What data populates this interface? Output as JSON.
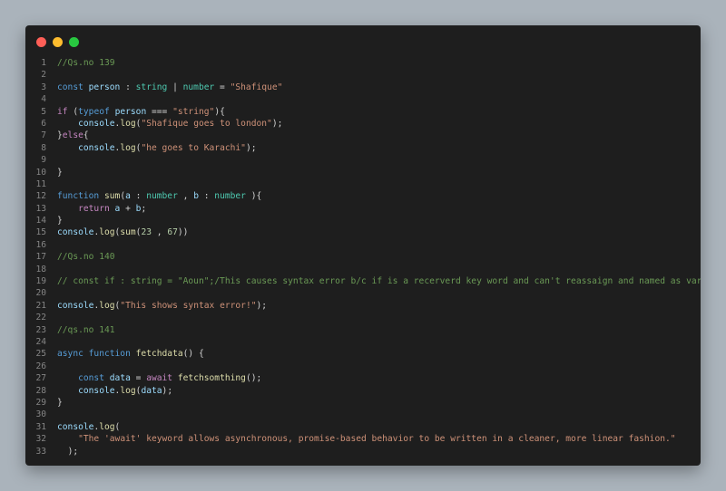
{
  "window": {
    "dots": [
      {
        "name": "close",
        "color": "#ff5f57"
      },
      {
        "name": "minimize",
        "color": "#febc2e"
      },
      {
        "name": "maximize",
        "color": "#28c840"
      }
    ]
  },
  "code": {
    "lines": [
      {
        "n": "1",
        "tokens": [
          {
            "t": "//Qs.no 139",
            "k": "cm"
          }
        ]
      },
      {
        "n": "2",
        "tokens": []
      },
      {
        "n": "3",
        "tokens": [
          {
            "t": "const ",
            "k": "kw"
          },
          {
            "t": "person",
            "k": "var"
          },
          {
            "t": " : ",
            "k": "op"
          },
          {
            "t": "string",
            "k": "ty"
          },
          {
            "t": " | ",
            "k": "op"
          },
          {
            "t": "number",
            "k": "ty"
          },
          {
            "t": " = ",
            "k": "op"
          },
          {
            "t": "\"Shafique\"",
            "k": "str"
          }
        ]
      },
      {
        "n": "4",
        "tokens": []
      },
      {
        "n": "5",
        "tokens": [
          {
            "t": "if",
            "k": "ctl"
          },
          {
            "t": " (",
            "k": "op"
          },
          {
            "t": "typeof",
            "k": "kw"
          },
          {
            "t": " ",
            "k": "op"
          },
          {
            "t": "person",
            "k": "var"
          },
          {
            "t": " === ",
            "k": "op"
          },
          {
            "t": "\"string\"",
            "k": "str"
          },
          {
            "t": "){",
            "k": "op"
          }
        ]
      },
      {
        "n": "6",
        "tokens": [
          {
            "t": "    ",
            "k": "op"
          },
          {
            "t": "console",
            "k": "var"
          },
          {
            "t": ".",
            "k": "op"
          },
          {
            "t": "log",
            "k": "fn"
          },
          {
            "t": "(",
            "k": "op"
          },
          {
            "t": "\"Shafique goes to london\"",
            "k": "str"
          },
          {
            "t": ");",
            "k": "op"
          }
        ]
      },
      {
        "n": "7",
        "tokens": [
          {
            "t": "}",
            "k": "op"
          },
          {
            "t": "else",
            "k": "ctl"
          },
          {
            "t": "{",
            "k": "op"
          }
        ]
      },
      {
        "n": "8",
        "tokens": [
          {
            "t": "    ",
            "k": "op"
          },
          {
            "t": "console",
            "k": "var"
          },
          {
            "t": ".",
            "k": "op"
          },
          {
            "t": "log",
            "k": "fn"
          },
          {
            "t": "(",
            "k": "op"
          },
          {
            "t": "\"he goes to Karachi\"",
            "k": "str"
          },
          {
            "t": ");",
            "k": "op"
          }
        ]
      },
      {
        "n": "9",
        "tokens": []
      },
      {
        "n": "10",
        "tokens": [
          {
            "t": "}",
            "k": "op"
          }
        ]
      },
      {
        "n": "11",
        "tokens": []
      },
      {
        "n": "12",
        "tokens": [
          {
            "t": "function ",
            "k": "kw"
          },
          {
            "t": "sum",
            "k": "fn"
          },
          {
            "t": "(",
            "k": "op"
          },
          {
            "t": "a",
            "k": "var"
          },
          {
            "t": " : ",
            "k": "op"
          },
          {
            "t": "number",
            "k": "ty"
          },
          {
            "t": " , ",
            "k": "op"
          },
          {
            "t": "b",
            "k": "var"
          },
          {
            "t": " : ",
            "k": "op"
          },
          {
            "t": "number",
            "k": "ty"
          },
          {
            "t": " ){",
            "k": "op"
          }
        ]
      },
      {
        "n": "13",
        "tokens": [
          {
            "t": "    ",
            "k": "op"
          },
          {
            "t": "return",
            "k": "ctl"
          },
          {
            "t": " ",
            "k": "op"
          },
          {
            "t": "a",
            "k": "var"
          },
          {
            "t": " + ",
            "k": "op"
          },
          {
            "t": "b",
            "k": "var"
          },
          {
            "t": ";",
            "k": "op"
          }
        ]
      },
      {
        "n": "14",
        "tokens": [
          {
            "t": "}",
            "k": "op"
          }
        ]
      },
      {
        "n": "15",
        "tokens": [
          {
            "t": "console",
            "k": "var"
          },
          {
            "t": ".",
            "k": "op"
          },
          {
            "t": "log",
            "k": "fn"
          },
          {
            "t": "(",
            "k": "op"
          },
          {
            "t": "sum",
            "k": "fn"
          },
          {
            "t": "(",
            "k": "op"
          },
          {
            "t": "23",
            "k": "num"
          },
          {
            "t": " , ",
            "k": "op"
          },
          {
            "t": "67",
            "k": "num"
          },
          {
            "t": "))",
            "k": "op"
          }
        ]
      },
      {
        "n": "16",
        "tokens": []
      },
      {
        "n": "17",
        "tokens": [
          {
            "t": "//Qs.no 140",
            "k": "cm"
          }
        ]
      },
      {
        "n": "18",
        "tokens": []
      },
      {
        "n": "19",
        "tokens": [
          {
            "t": "// const if : string = \"Aoun\";/This causes syntax error b/c if is a recerverd key word and can't reassaign and named as varialbe",
            "k": "cm"
          }
        ]
      },
      {
        "n": "20",
        "tokens": []
      },
      {
        "n": "21",
        "tokens": [
          {
            "t": "console",
            "k": "var"
          },
          {
            "t": ".",
            "k": "op"
          },
          {
            "t": "log",
            "k": "fn"
          },
          {
            "t": "(",
            "k": "op"
          },
          {
            "t": "\"This shows syntax error!\"",
            "k": "str"
          },
          {
            "t": ");",
            "k": "op"
          }
        ]
      },
      {
        "n": "22",
        "tokens": []
      },
      {
        "n": "23",
        "tokens": [
          {
            "t": "//qs.no 141",
            "k": "cm"
          }
        ]
      },
      {
        "n": "24",
        "tokens": []
      },
      {
        "n": "25",
        "tokens": [
          {
            "t": "async ",
            "k": "kw"
          },
          {
            "t": "function ",
            "k": "kw"
          },
          {
            "t": "fetchdata",
            "k": "fn"
          },
          {
            "t": "() {",
            "k": "op"
          }
        ]
      },
      {
        "n": "26",
        "tokens": []
      },
      {
        "n": "27",
        "tokens": [
          {
            "t": "    ",
            "k": "op"
          },
          {
            "t": "const ",
            "k": "kw"
          },
          {
            "t": "data",
            "k": "var"
          },
          {
            "t": " = ",
            "k": "op"
          },
          {
            "t": "await",
            "k": "ctl"
          },
          {
            "t": " ",
            "k": "op"
          },
          {
            "t": "fetchsomthing",
            "k": "fn"
          },
          {
            "t": "();",
            "k": "op"
          }
        ]
      },
      {
        "n": "28",
        "tokens": [
          {
            "t": "    ",
            "k": "op"
          },
          {
            "t": "console",
            "k": "var"
          },
          {
            "t": ".",
            "k": "op"
          },
          {
            "t": "log",
            "k": "fn"
          },
          {
            "t": "(",
            "k": "op"
          },
          {
            "t": "data",
            "k": "var"
          },
          {
            "t": ");",
            "k": "op"
          }
        ]
      },
      {
        "n": "29",
        "tokens": [
          {
            "t": "}",
            "k": "op"
          }
        ]
      },
      {
        "n": "30",
        "tokens": []
      },
      {
        "n": "31",
        "tokens": [
          {
            "t": "console",
            "k": "var"
          },
          {
            "t": ".",
            "k": "op"
          },
          {
            "t": "log",
            "k": "fn"
          },
          {
            "t": "(",
            "k": "op"
          }
        ]
      },
      {
        "n": "32",
        "tokens": [
          {
            "t": "    ",
            "k": "op"
          },
          {
            "t": "\"The 'await' keyword allows asynchronous, promise-based behavior to be written in a cleaner, more linear fashion.\"",
            "k": "str"
          }
        ]
      },
      {
        "n": "33",
        "tokens": [
          {
            "t": "  ",
            "k": "op"
          },
          {
            "t": ");",
            "k": "op"
          }
        ]
      }
    ]
  }
}
